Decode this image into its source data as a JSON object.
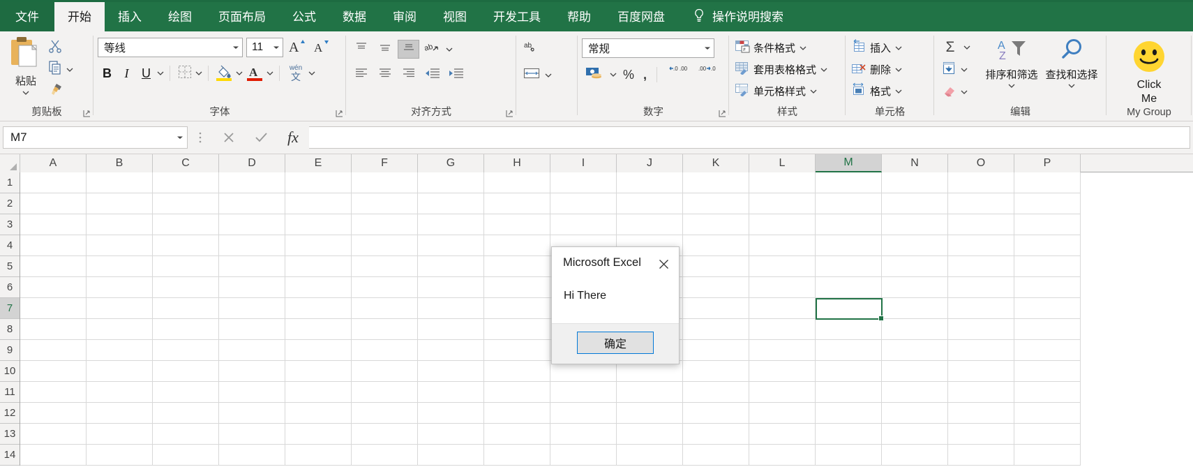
{
  "tabs": [
    {
      "label": "文件",
      "name": "tab-file",
      "state": "file"
    },
    {
      "label": "开始",
      "name": "tab-home",
      "state": "active"
    },
    {
      "label": "插入",
      "name": "tab-insert",
      "state": ""
    },
    {
      "label": "绘图",
      "name": "tab-draw",
      "state": ""
    },
    {
      "label": "页面布局",
      "name": "tab-page-layout",
      "state": ""
    },
    {
      "label": "公式",
      "name": "tab-formulas",
      "state": ""
    },
    {
      "label": "数据",
      "name": "tab-data",
      "state": ""
    },
    {
      "label": "审阅",
      "name": "tab-review",
      "state": ""
    },
    {
      "label": "视图",
      "name": "tab-view",
      "state": ""
    },
    {
      "label": "开发工具",
      "name": "tab-developer",
      "state": ""
    },
    {
      "label": "帮助",
      "name": "tab-help",
      "state": ""
    },
    {
      "label": "百度网盘",
      "name": "tab-baidu-netdisk",
      "state": ""
    }
  ],
  "tellme": {
    "label": "操作说明搜索",
    "icon": "lightbulb-icon"
  },
  "ribbon": {
    "clipboard": {
      "group_label": "剪贴板",
      "paste_label": "粘贴",
      "paste_icon": "paste-icon",
      "cut_icon": "scissors-icon",
      "copy_icon": "copy-icon",
      "format_painter_icon": "format-painter-icon"
    },
    "font": {
      "group_label": "字体",
      "font_name": "等线",
      "font_size": "11",
      "grow_font": "A",
      "shrink_font": "A",
      "bold": "B",
      "italic": "I",
      "underline": "U",
      "borders_icon": "borders-icon",
      "fill_color_icon": "fill-color-icon",
      "fill_color": "#ffd900",
      "font_color_icon": "font-color-icon",
      "font_color": "#e01b00",
      "phonetic_top": "wén",
      "phonetic_bottom": "文"
    },
    "alignment": {
      "group_label": "对齐方式",
      "align_top_icon": "align-top-icon",
      "align_middle_icon": "align-middle-icon",
      "align_bottom_icon": "align-bottom-icon",
      "orientation_icon": "text-orientation-icon",
      "align_left_icon": "align-left-icon",
      "align_center_icon": "align-center-icon",
      "align_right_icon": "align-right-icon",
      "decrease_indent_icon": "decrease-indent-icon",
      "increase_indent_icon": "increase-indent-icon",
      "wrap_text_icon": "wrap-text-icon",
      "merge_cells_icon": "merge-cells-icon"
    },
    "number": {
      "group_label": "数字",
      "format_value": "常规",
      "currency_icon": "currency-icon",
      "percent": "%",
      "comma": ",",
      "increase_decimal_icon": "increase-decimal-icon",
      "decrease_decimal_icon": "decrease-decimal-icon",
      "decimal_zeros": ".00",
      "decimal_zeros2": ".0"
    },
    "styles": {
      "group_label": "样式",
      "items": [
        {
          "label": "条件格式",
          "icon": "conditional-formatting-icon"
        },
        {
          "label": "套用表格格式",
          "icon": "format-as-table-icon"
        },
        {
          "label": "单元格样式",
          "icon": "cell-styles-icon"
        }
      ]
    },
    "cells": {
      "group_label": "单元格",
      "items": [
        {
          "label": "插入",
          "icon": "insert-cells-icon"
        },
        {
          "label": "删除",
          "icon": "delete-cells-icon"
        },
        {
          "label": "格式",
          "icon": "format-cells-icon"
        }
      ]
    },
    "editing": {
      "group_label": "编辑",
      "autosum_icon": "sigma-autosum-icon",
      "autosum_glyph": "Σ",
      "fill_icon": "fill-down-icon",
      "clear_icon": "eraser-clear-icon",
      "sort_filter_label": "排序和筛选",
      "sort_filter_icon": "sort-filter-icon",
      "find_select_label": "查找和选择",
      "find_select_icon": "magnifier-icon"
    },
    "mygroup": {
      "group_label": "My Group",
      "button_label_line1": "Click",
      "button_label_line2": "Me",
      "button_icon": "smiley-face-icon",
      "smiley_color": "#ffd531"
    }
  },
  "formula_bar": {
    "name_box_value": "M7",
    "cancel_icon": "cancel-x-icon",
    "enter_icon": "enter-check-icon",
    "function_icon": "fx-insert-function-icon",
    "function_label": "fx",
    "formula_value": "",
    "grip_icon": "drag-grip-icon"
  },
  "grid": {
    "columns": [
      "A",
      "B",
      "C",
      "D",
      "E",
      "F",
      "G",
      "H",
      "I",
      "J",
      "K",
      "L",
      "M",
      "N",
      "O",
      "P"
    ],
    "rows": [
      "1",
      "2",
      "3",
      "4",
      "5",
      "6",
      "7",
      "8",
      "9",
      "10",
      "11",
      "12",
      "13",
      "14"
    ],
    "selected_cell": "M7",
    "selected_column": "M",
    "selected_row": "7",
    "accent_color": "#217346"
  },
  "dialog": {
    "title": "Microsoft Excel",
    "message": "Hi There",
    "ok_label": "确定",
    "close_icon": "close-x-icon"
  }
}
